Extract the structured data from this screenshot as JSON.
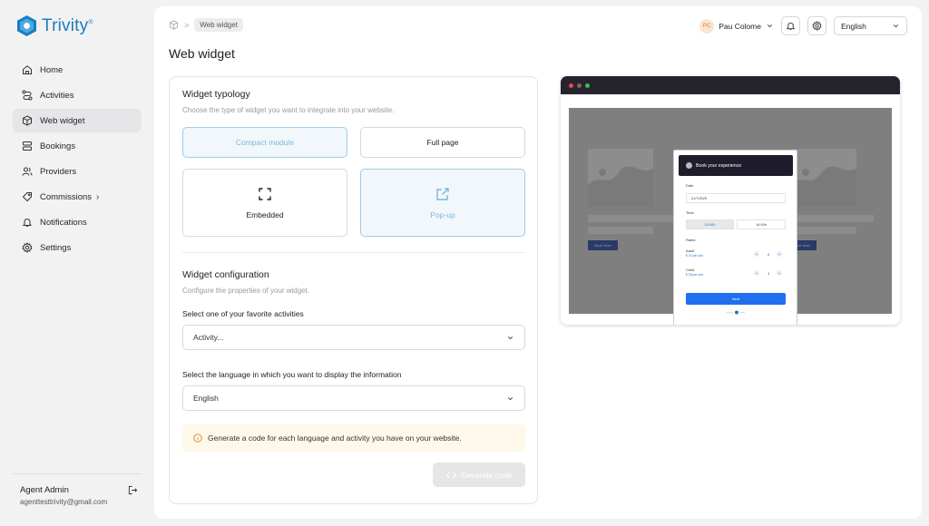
{
  "brand": {
    "name": "Trivity",
    "mark": "®",
    "color": "#1a7dc2"
  },
  "sidebar": {
    "items": [
      {
        "label": "Home",
        "icon": "home-icon"
      },
      {
        "label": "Activities",
        "icon": "activities-icon"
      },
      {
        "label": "Web widget",
        "icon": "cube-icon",
        "active": true
      },
      {
        "label": "Bookings",
        "icon": "bookings-icon"
      },
      {
        "label": "Providers",
        "icon": "users-icon"
      },
      {
        "label": "Commissions",
        "icon": "commissions-icon",
        "chevron": "›"
      },
      {
        "label": "Notifications",
        "icon": "bell-icon"
      },
      {
        "label": "Settings",
        "icon": "gear-icon"
      }
    ],
    "footer": {
      "name": "Agent Admin",
      "email": "agenttesttrivity@gmail.com"
    }
  },
  "header": {
    "breadcrumb": {
      "current": "Web widget"
    },
    "user": {
      "initials": "PC",
      "name": "Pau Colome"
    },
    "language": "English"
  },
  "page": {
    "title": "Web widget"
  },
  "typology": {
    "title": "Widget typology",
    "description": "Choose the type of widget you want to integrate into your website.",
    "options": [
      {
        "label": "Compact module",
        "selected": true
      },
      {
        "label": "Full page",
        "selected": false
      },
      {
        "label": "Embedded",
        "selected": false,
        "icon": "expand-icon"
      },
      {
        "label": "Pop-up",
        "selected": true,
        "icon": "external-link-icon"
      }
    ]
  },
  "config": {
    "title": "Widget configuration",
    "description": "Configure the properties of your widget.",
    "activity_label": "Select one of your favorite activities",
    "activity_value": "Activity...",
    "language_label": "Select the language in which you want to display the information",
    "language_value": "English",
    "info": "Generate a code for each language and activity you have on your website.",
    "generate_label": "Generate code",
    "generate_icon": "code-icon"
  },
  "preview": {
    "modal_title": "Book your experience",
    "date_label": "Date",
    "date_value": "21/7/2025",
    "time_label": "Time",
    "times": [
      "10:00h",
      "14:00h"
    ],
    "rates_label": "Rates",
    "rates": [
      {
        "name": "Adult",
        "price": "€ 37 per unit",
        "qty": "2"
      },
      {
        "name": "Child",
        "price": "€ 25 per unit",
        "qty": "1"
      }
    ],
    "next_label": "Next",
    "book_now": "Book Now",
    "dot_colors": [
      "#e5484d",
      "#7c6a6a",
      "#3fbf4a"
    ]
  }
}
